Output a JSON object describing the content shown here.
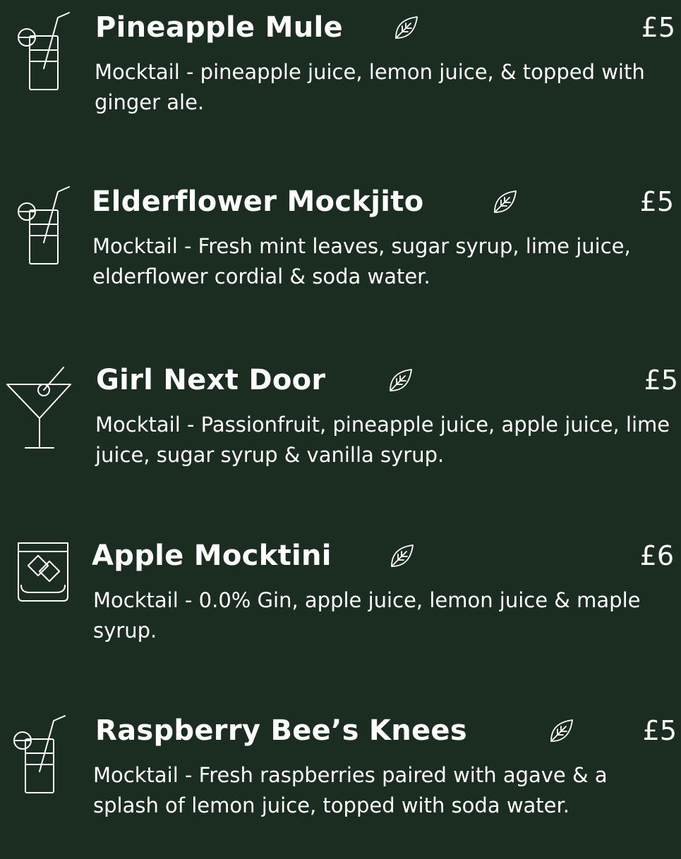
{
  "colors": {
    "background": "#1b2c21",
    "text": "#ffffff"
  },
  "items": [
    {
      "name": "Pineapple Mule",
      "price": "£5",
      "icon": "highball-straw-icon",
      "description": "Mocktail - pineapple juice, lemon juice, & topped with ginger ale."
    },
    {
      "name": "Elderflower Mockjito",
      "price": "£5",
      "icon": "highball-straw-icon",
      "description": "Mocktail - Fresh mint leaves, sugar syrup, lime juice, elderflower cordial & soda water."
    },
    {
      "name": "Girl Next Door",
      "price": "£5",
      "icon": "martini-glass-icon",
      "description": "Mocktail - Passionfruit, pineapple juice, apple juice, lime juice, sugar syrup & vanilla syrup."
    },
    {
      "name": "Apple Mocktini",
      "price": "£6",
      "icon": "rocks-glass-icon",
      "description": "Mocktail - 0.0% Gin, apple juice, lemon juice & maple syrup."
    },
    {
      "name": "Raspberry Bee’s Knees",
      "price": "£5",
      "icon": "highball-straw-icon",
      "description": "Mocktail - Fresh raspberries paired with agave & a splash of lemon juice, topped with soda water."
    }
  ],
  "vegan_icon": "leaf-icon"
}
